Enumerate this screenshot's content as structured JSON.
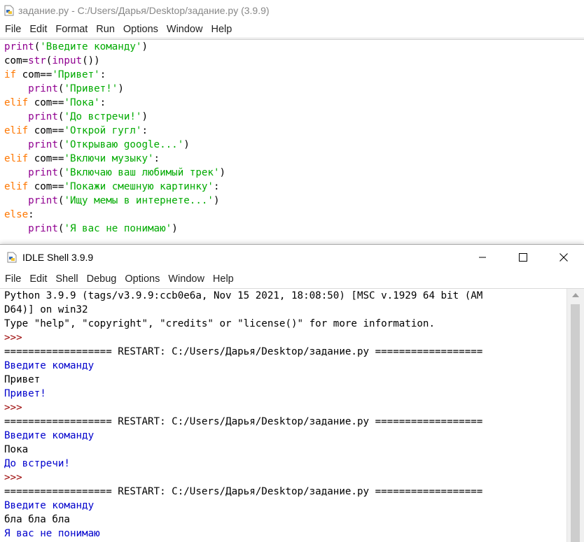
{
  "editor": {
    "title": "задание.py - C:/Users/Дарья/Desktop/задание.py (3.9.9)",
    "menu": [
      "File",
      "Edit",
      "Format",
      "Run",
      "Options",
      "Window",
      "Help"
    ],
    "code_lines": [
      [
        [
          "bi",
          "print"
        ],
        [
          "t",
          "("
        ],
        [
          "st",
          "'Введите команду'"
        ],
        [
          "t",
          ")"
        ]
      ],
      [
        [
          "t",
          "com="
        ],
        [
          "bi",
          "str"
        ],
        [
          "t",
          "("
        ],
        [
          "bi",
          "input"
        ],
        [
          "t",
          "())"
        ]
      ],
      [
        [
          "kw",
          "if"
        ],
        [
          "t",
          " com=="
        ],
        [
          "st",
          "'Привет'"
        ],
        [
          "t",
          ":"
        ]
      ],
      [
        [
          "t",
          "    "
        ],
        [
          "bi",
          "print"
        ],
        [
          "t",
          "("
        ],
        [
          "st",
          "'Привет!'"
        ],
        [
          "t",
          ")"
        ]
      ],
      [
        [
          "kw",
          "elif"
        ],
        [
          "t",
          " com=="
        ],
        [
          "st",
          "'Пока'"
        ],
        [
          "t",
          ":"
        ]
      ],
      [
        [
          "t",
          "    "
        ],
        [
          "bi",
          "print"
        ],
        [
          "t",
          "("
        ],
        [
          "st",
          "'До встречи!'"
        ],
        [
          "t",
          ")"
        ]
      ],
      [
        [
          "kw",
          "elif"
        ],
        [
          "t",
          " com=="
        ],
        [
          "st",
          "'Открой гугл'"
        ],
        [
          "t",
          ":"
        ]
      ],
      [
        [
          "t",
          "    "
        ],
        [
          "bi",
          "print"
        ],
        [
          "t",
          "("
        ],
        [
          "st",
          "'Открываю google...'"
        ],
        [
          "t",
          ")"
        ]
      ],
      [
        [
          "kw",
          "elif"
        ],
        [
          "t",
          " com=="
        ],
        [
          "st",
          "'Включи музыку'"
        ],
        [
          "t",
          ":"
        ]
      ],
      [
        [
          "t",
          "    "
        ],
        [
          "bi",
          "print"
        ],
        [
          "t",
          "("
        ],
        [
          "st",
          "'Включаю ваш любимый трек'"
        ],
        [
          "t",
          ")"
        ]
      ],
      [
        [
          "kw",
          "elif"
        ],
        [
          "t",
          " com=="
        ],
        [
          "st",
          "'Покажи смешную картинку'"
        ],
        [
          "t",
          ":"
        ]
      ],
      [
        [
          "t",
          "    "
        ],
        [
          "bi",
          "print"
        ],
        [
          "t",
          "("
        ],
        [
          "st",
          "'Ищу мемы в интернете...'"
        ],
        [
          "t",
          ")"
        ]
      ],
      [
        [
          "kw",
          "else"
        ],
        [
          "t",
          ":"
        ]
      ],
      [
        [
          "t",
          "    "
        ],
        [
          "bi",
          "print"
        ],
        [
          "t",
          "("
        ],
        [
          "st",
          "'Я вас не понимаю'"
        ],
        [
          "t",
          ")"
        ]
      ]
    ]
  },
  "shell": {
    "title": "IDLE Shell 3.9.9",
    "menu": [
      "File",
      "Edit",
      "Shell",
      "Debug",
      "Options",
      "Window",
      "Help"
    ],
    "lines": [
      [
        "out",
        "Python 3.9.9 (tags/v3.9.9:ccb0e6a, Nov 15 2021, 18:08:50) [MSC v.1929 64 bit (AM"
      ],
      [
        "out",
        "D64)] on win32"
      ],
      [
        "out",
        "Type \"help\", \"copyright\", \"credits\" or \"license()\" for more information."
      ],
      [
        "prompt",
        ">>> "
      ],
      [
        "out",
        "================== RESTART: C:/Users/Дарья/Desktop/задание.py =================="
      ],
      [
        "stdout",
        "Введите команду"
      ],
      [
        "input",
        "Привет"
      ],
      [
        "stdout",
        "Привет!"
      ],
      [
        "prompt",
        ">>> "
      ],
      [
        "out",
        "================== RESTART: C:/Users/Дарья/Desktop/задание.py =================="
      ],
      [
        "stdout",
        "Введите команду"
      ],
      [
        "input",
        "Пока"
      ],
      [
        "stdout",
        "До встречи!"
      ],
      [
        "prompt",
        ">>> "
      ],
      [
        "out",
        "================== RESTART: C:/Users/Дарья/Desktop/задание.py =================="
      ],
      [
        "stdout",
        "Введите команду"
      ],
      [
        "input",
        "бла бла бла"
      ],
      [
        "stdout",
        "Я вас не понимаю"
      ]
    ]
  }
}
